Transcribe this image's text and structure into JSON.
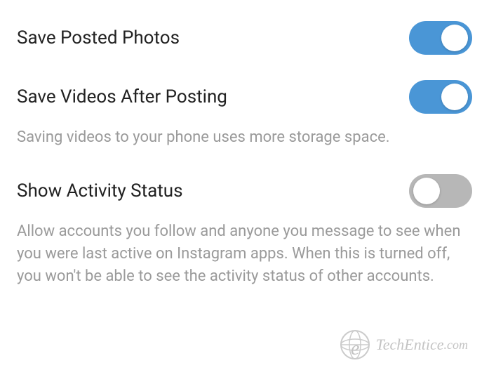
{
  "settings": [
    {
      "title": "Save Posted Photos",
      "enabled": true,
      "description": null
    },
    {
      "title": "Save Videos After Posting",
      "enabled": true,
      "description": "Saving videos to your phone uses more storage space."
    },
    {
      "title": "Show Activity Status",
      "enabled": false,
      "description": "Allow accounts you follow and anyone you message to see when you were last active on Instagram apps. When this is turned off, you won't be able to see the activity status of other accounts."
    }
  ],
  "watermark": {
    "brand": "TechEntice",
    "suffix": ".com"
  }
}
